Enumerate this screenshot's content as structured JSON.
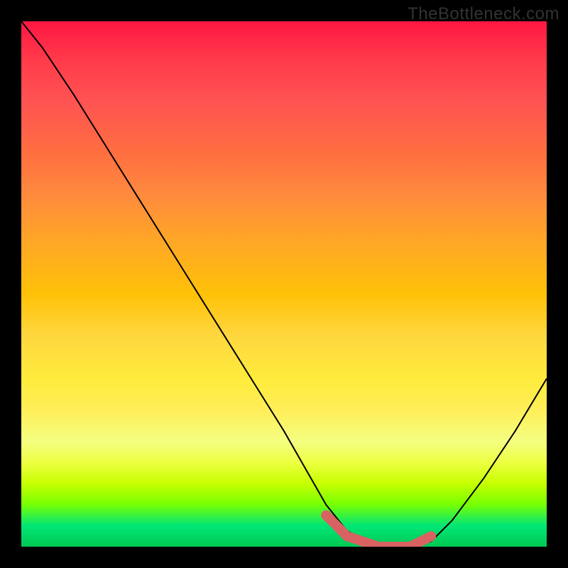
{
  "watermark": "TheBottleneck.com",
  "chart_data": {
    "type": "line",
    "title": "",
    "xlabel": "",
    "ylabel": "",
    "xlim": [
      0,
      100
    ],
    "ylim": [
      0,
      100
    ],
    "series": [
      {
        "name": "bottleneck-curve",
        "x": [
          0,
          4,
          10,
          20,
          30,
          40,
          50,
          58,
          62,
          68,
          74,
          78,
          82,
          88,
          94,
          100
        ],
        "values": [
          100,
          95,
          86,
          70,
          54,
          38,
          22,
          8,
          3,
          0,
          0,
          1,
          5,
          13,
          22,
          32
        ]
      }
    ],
    "highlight_segment": {
      "name": "optimal-range",
      "x": [
        58,
        62,
        68,
        74,
        78
      ],
      "values": [
        6,
        2,
        0,
        0,
        2
      ]
    }
  },
  "colors": {
    "curve": "#000000",
    "highlight": "#d86262",
    "bg_top": "#ff1744",
    "bg_bottom": "#00c853"
  }
}
